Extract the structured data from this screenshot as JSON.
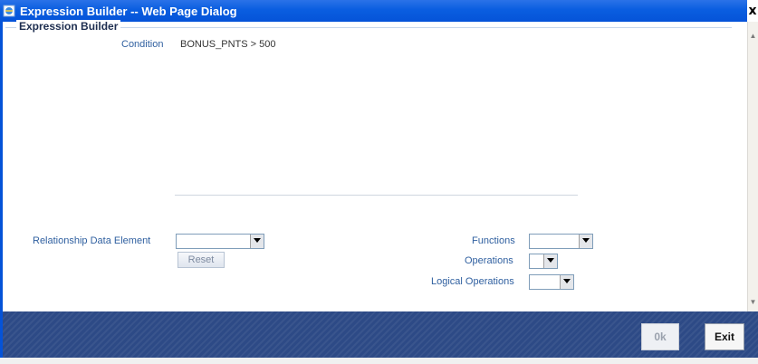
{
  "window": {
    "title": "Expression Builder -- Web Page Dialog",
    "close_glyph": "x"
  },
  "section": {
    "legend": "Expression Builder"
  },
  "condition": {
    "label": "Condition",
    "value": "BONUS_PNTS > 500"
  },
  "form": {
    "relationship_label": "Relationship Data Element",
    "relationship_value": "",
    "reset_label": "Reset",
    "functions_label": "Functions",
    "functions_value": "",
    "operations_label": "Operations",
    "operations_value": "",
    "logical_operations_label": "Logical Operations",
    "logical_operations_value": ""
  },
  "footer": {
    "ok_label": "0k",
    "exit_label": "Exit"
  },
  "colors": {
    "titlebar": "#0a5ee0",
    "footer": "#2d4a86",
    "label_text": "#3060a0"
  },
  "icons": {
    "app": "ie-page-icon",
    "dropdown": "chevron-down-icon",
    "close": "close-icon"
  }
}
